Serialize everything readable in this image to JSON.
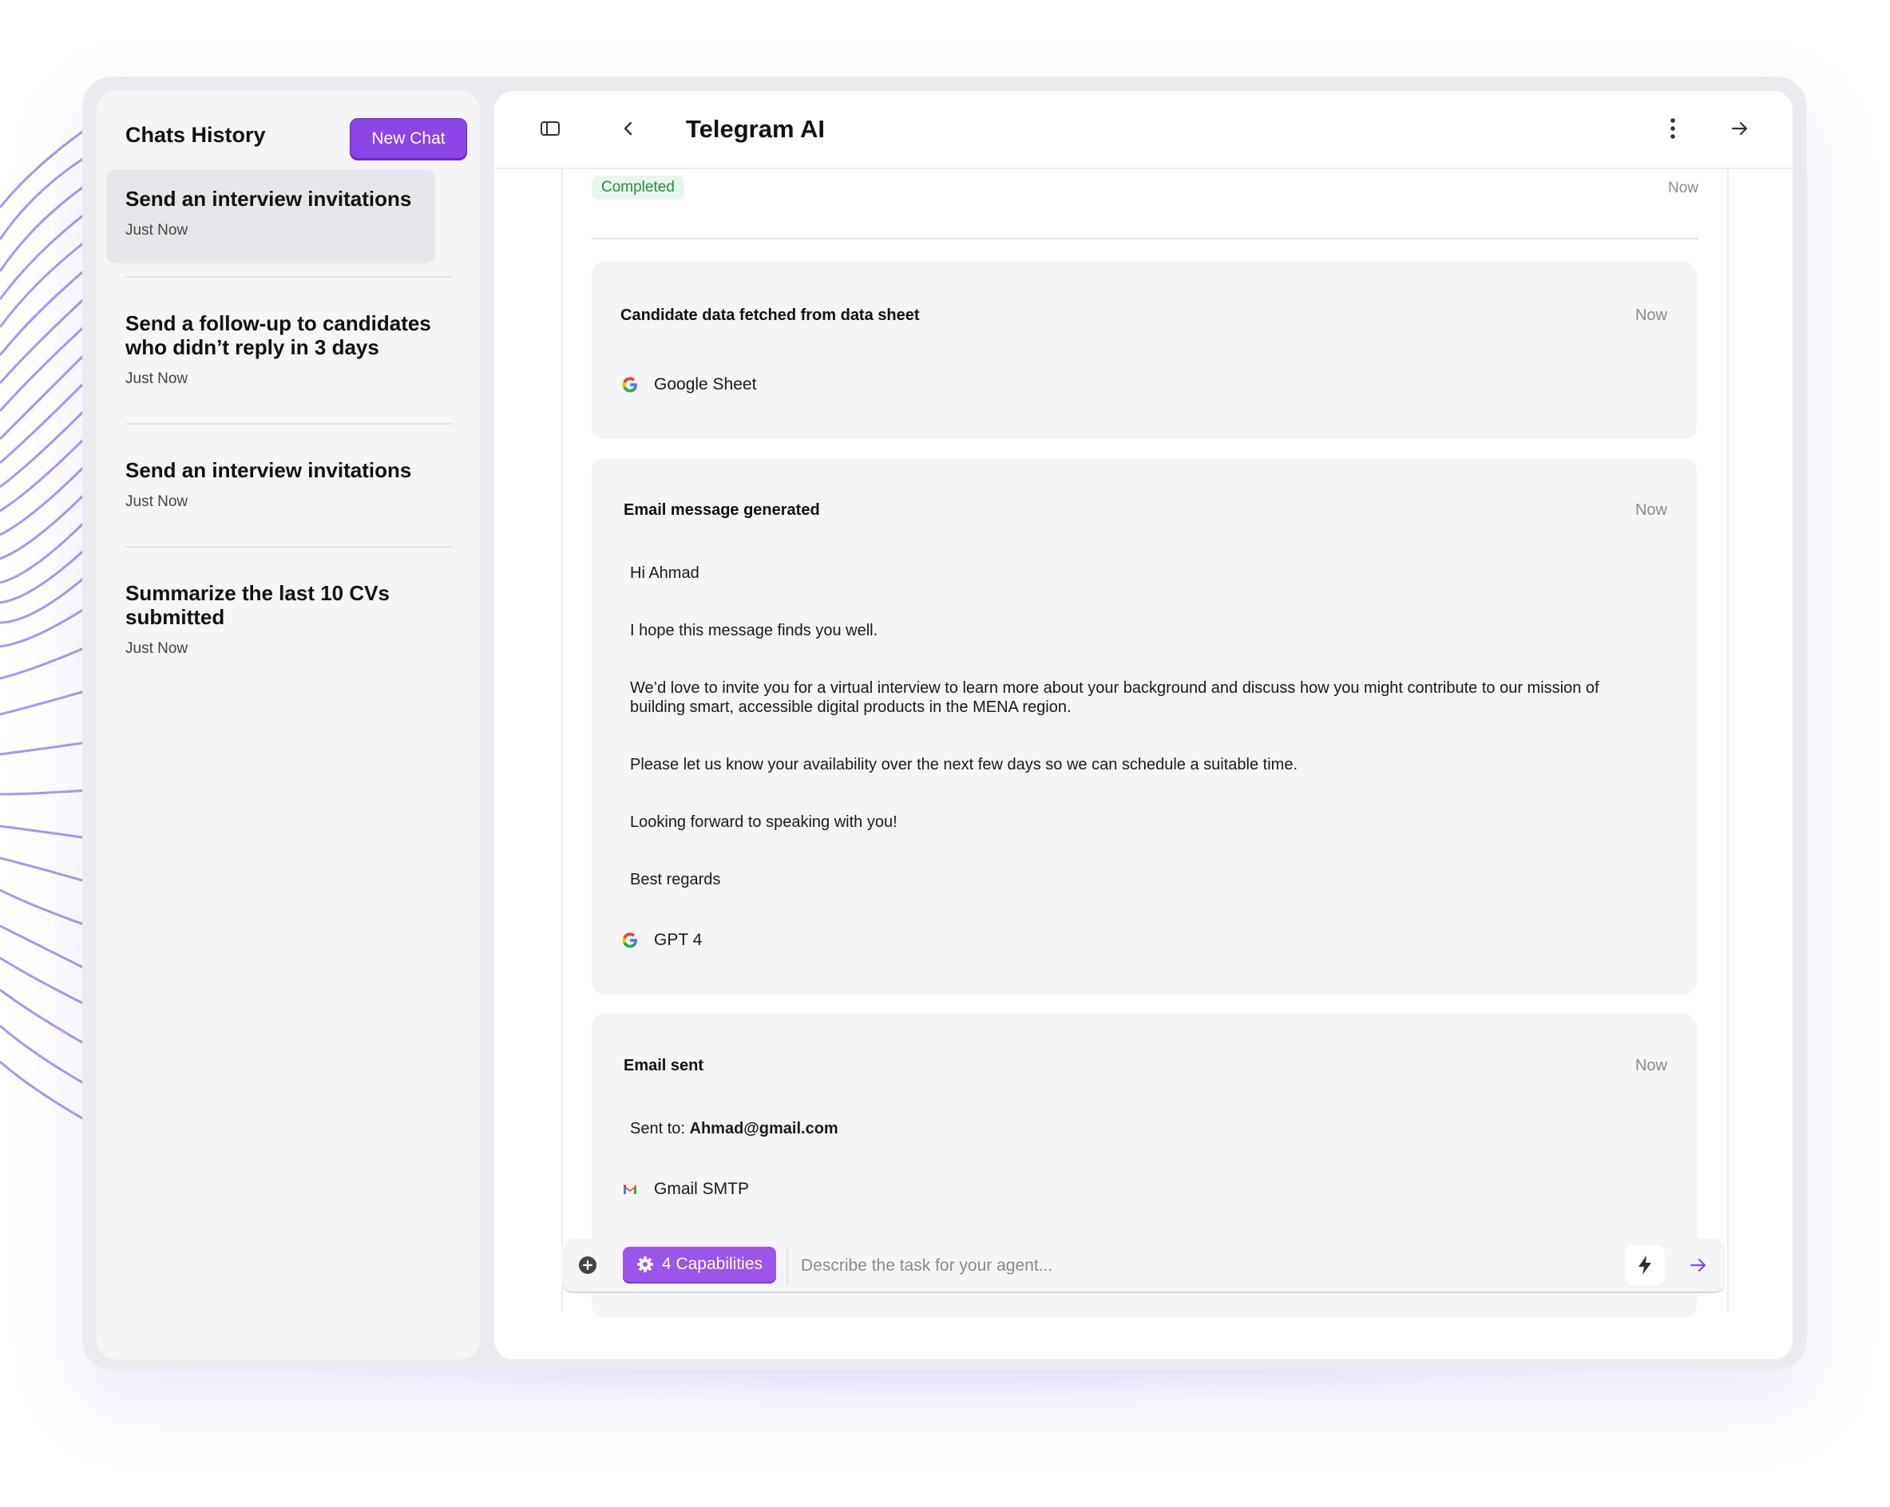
{
  "sidebar": {
    "title": "Chats History",
    "new_chat_label": "New Chat",
    "items": [
      {
        "title": "Send an interview invitations",
        "time": "Just Now"
      },
      {
        "title": "Send a follow-up to candidates who didn’t reply in 3 days",
        "time": "Just Now"
      },
      {
        "title": "Send an interview invitations",
        "time": "Just Now"
      },
      {
        "title": "Summarize the last 10 CVs submitted",
        "time": "Just Now"
      }
    ]
  },
  "header": {
    "title": "Telegram AI"
  },
  "thread": {
    "status_badge": "Completed",
    "status_time": "Now",
    "cards": [
      {
        "title": "Candidate data fetched from data sheet",
        "time": "Now",
        "source": "Google Sheet",
        "source_icon": "google-icon"
      },
      {
        "title": "Email message generated",
        "time": "Now",
        "paragraphs": [
          "Hi Ahmad",
          "I hope this message finds you well.",
          "We’d love to invite you for a virtual interview to learn more about your background and discuss how you might contribute to our mission of building smart, accessible digital products in the MENA region.",
          "Please let us know your availability over the next few days so we can schedule a suitable time.",
          "Looking forward to speaking with you!",
          "Best regards"
        ],
        "source": "GPT 4",
        "source_icon": "google-icon"
      },
      {
        "title": "Email sent",
        "time": "Now",
        "sent_to_label": "Sent to:",
        "sent_to_value": "Ahmad@gmail.com",
        "source": "Gmail SMTP",
        "source_icon": "gmail-icon"
      }
    ]
  },
  "composer": {
    "capabilities_label": "4 Capabilities",
    "placeholder": "Describe the task for your agent..."
  },
  "colors": {
    "accent": "#8b45e6",
    "completed_bg": "#e6f6ec",
    "completed_text": "#2a8a4a"
  }
}
